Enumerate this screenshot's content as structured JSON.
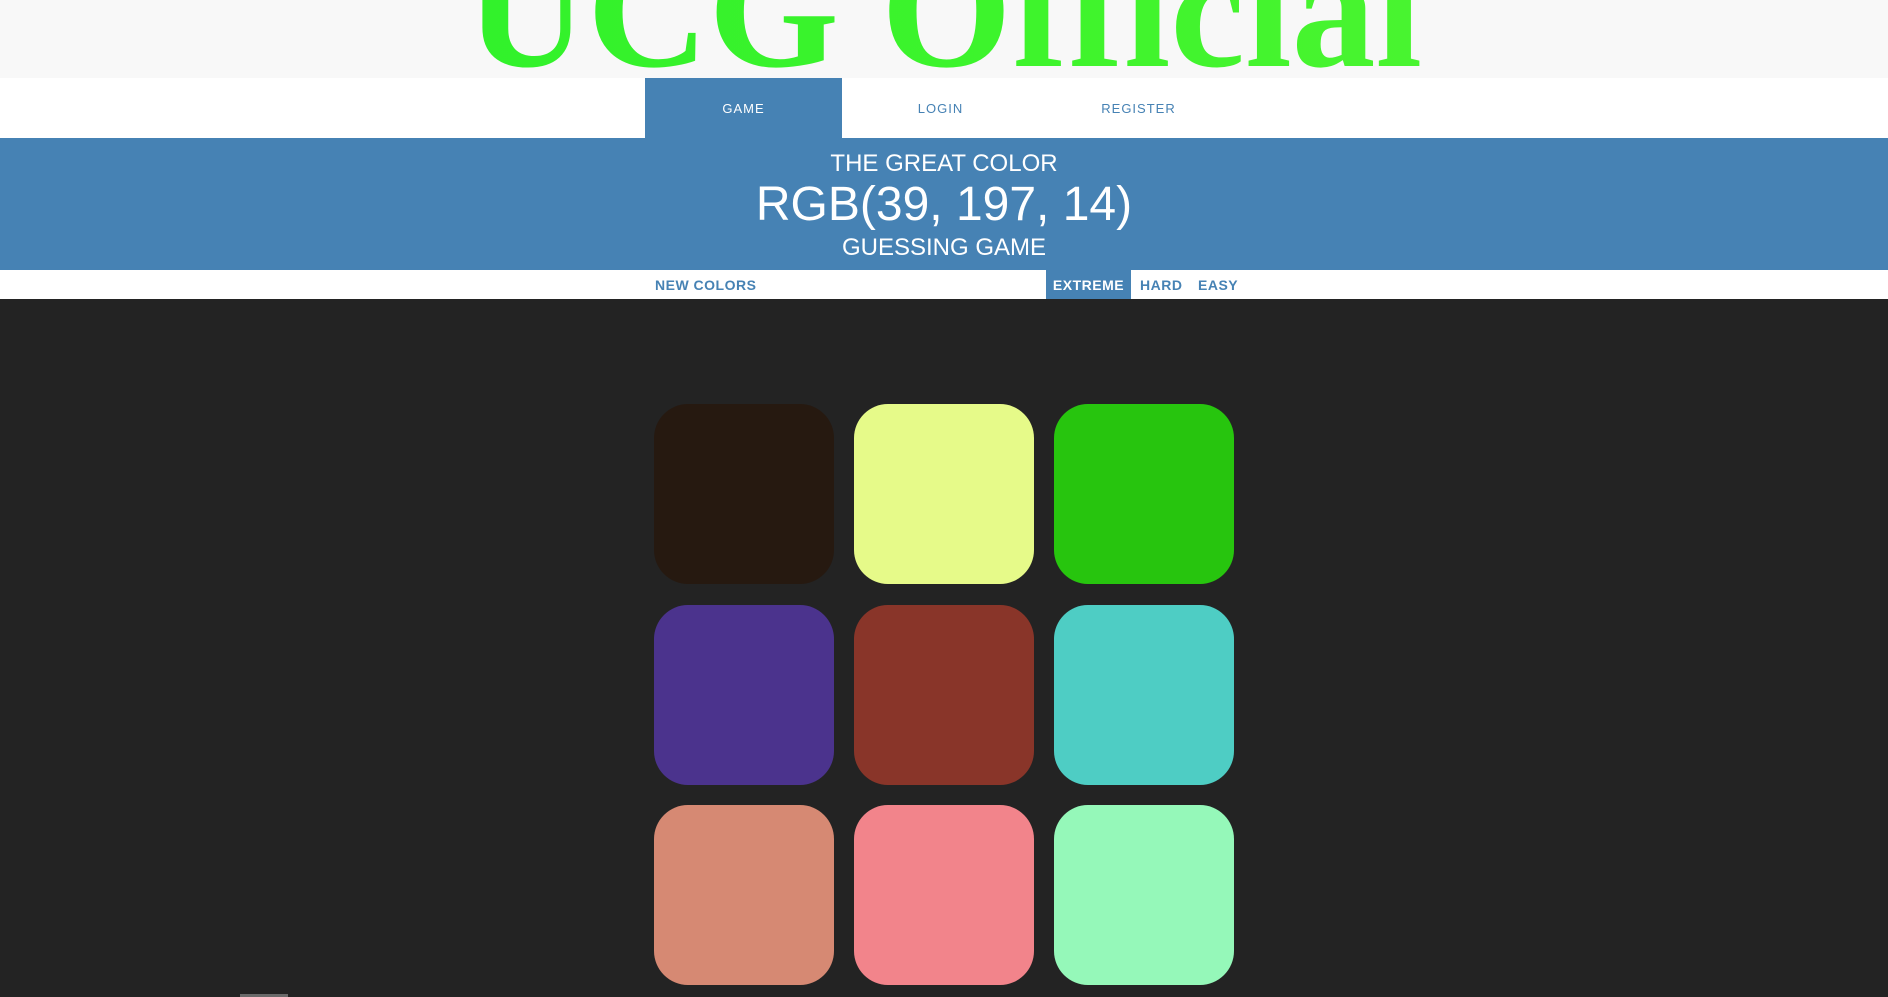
{
  "banner": {
    "title": "UCG Official"
  },
  "nav": {
    "tabs": [
      {
        "label": "GAME",
        "active": true
      },
      {
        "label": "LOGIN",
        "active": false
      },
      {
        "label": "REGISTER",
        "active": false
      }
    ]
  },
  "header": {
    "line1": "THE GREAT COLOR",
    "rgb": "RGB(39, 197, 14)",
    "line3": "GUESSING GAME"
  },
  "controls": {
    "new_colors": "NEW COLORS",
    "modes": [
      {
        "label": "EXTREME",
        "active": true
      },
      {
        "label": "HARD",
        "active": false
      },
      {
        "label": "EASY",
        "active": false
      }
    ]
  },
  "colors": {
    "accent": "#4682b4",
    "background": "#232323",
    "banner_text": "#3ef42c"
  },
  "squares": [
    {
      "color": "#261910"
    },
    {
      "color": "#e6fa89"
    },
    {
      "color": "#27c50e"
    },
    {
      "color": "#4b338d"
    },
    {
      "color": "#893529"
    },
    {
      "color": "#4ecdc4"
    },
    {
      "color": "#d68973"
    },
    {
      "color": "#f2848b"
    },
    {
      "color": "#95f8b9"
    }
  ]
}
